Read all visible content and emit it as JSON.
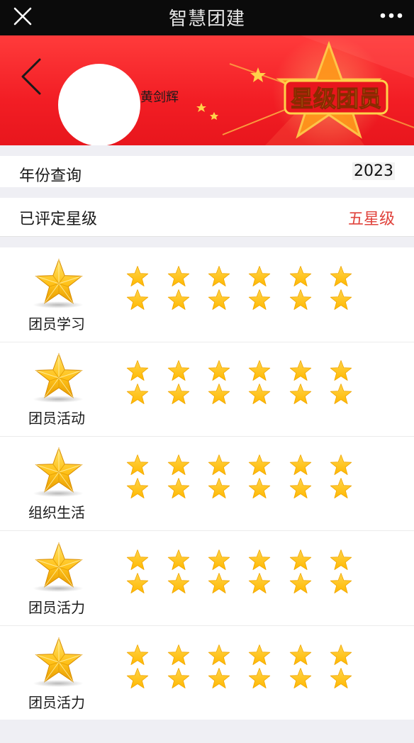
{
  "header": {
    "title": "智慧团建",
    "close_icon": "close-icon",
    "more_icon": "more-icon"
  },
  "banner": {
    "user_name": "黄剑辉",
    "badge_text": "星级团员",
    "background_color": "#f21d24"
  },
  "year_query": {
    "label": "年份查询",
    "value": "2023"
  },
  "rated_stars": {
    "label": "已评定星级",
    "value": "五星级",
    "value_color": "#e0433c"
  },
  "categories": [
    {
      "label": "团员学习",
      "stars": 12
    },
    {
      "label": "团员活动",
      "stars": 12
    },
    {
      "label": "组织生活",
      "stars": 12
    },
    {
      "label": "团员活力",
      "stars": 12
    },
    {
      "label": "团员活力",
      "stars": 12
    }
  ],
  "colors": {
    "star": "#ffc21a",
    "star_dark": "#f0a500"
  }
}
